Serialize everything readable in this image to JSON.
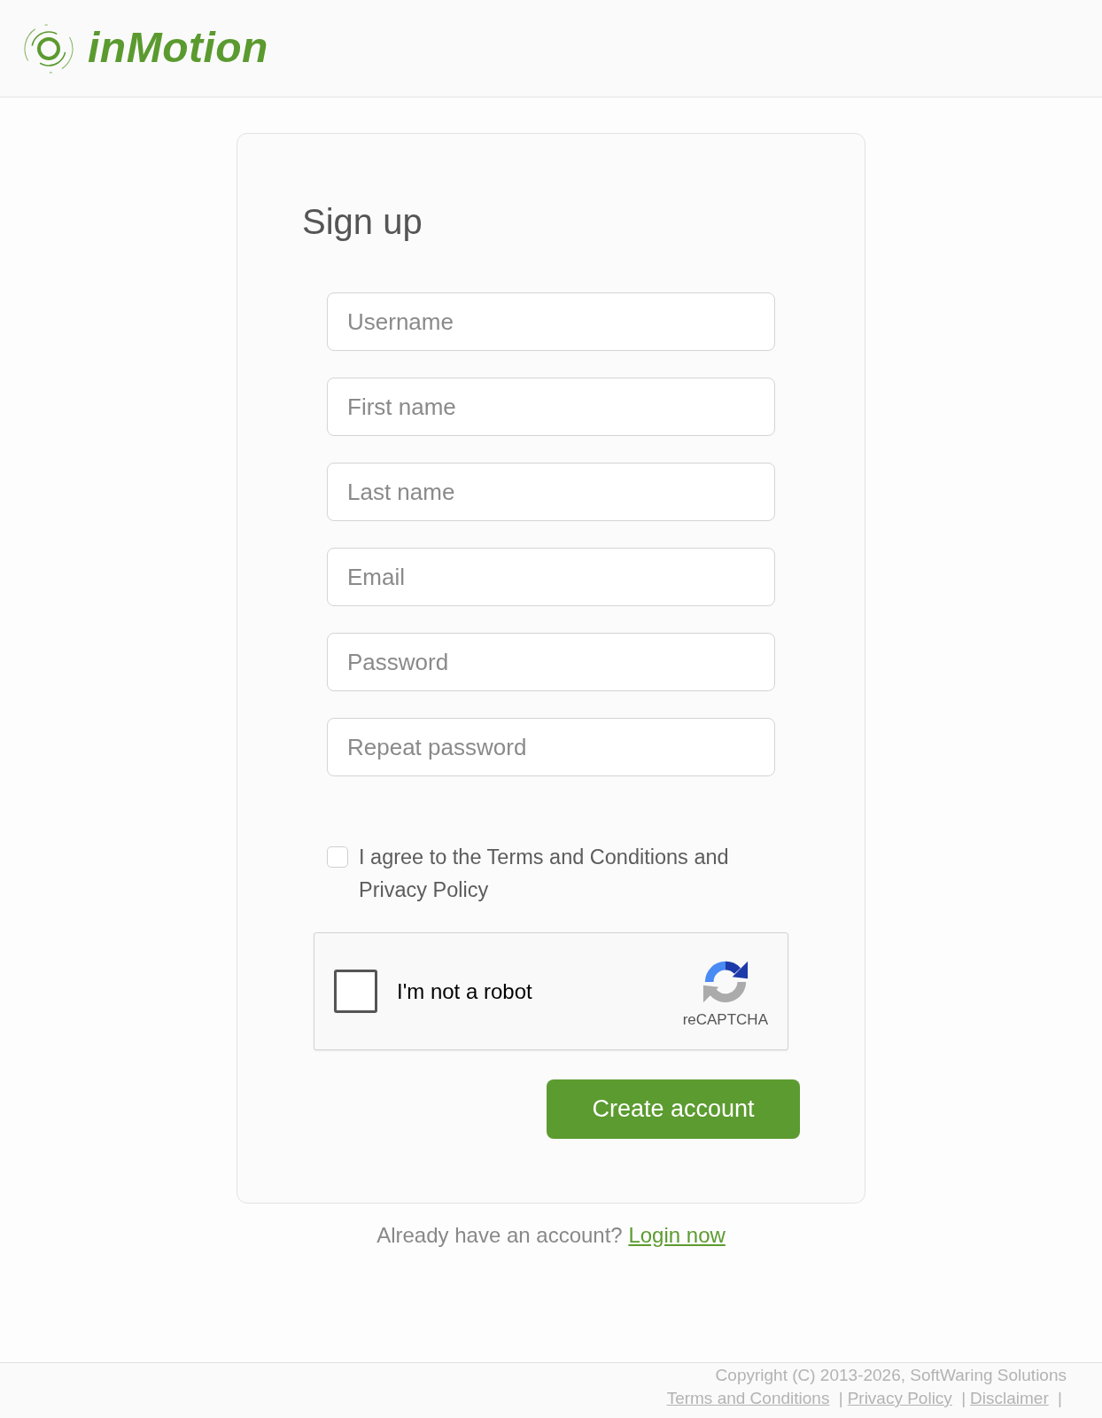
{
  "header": {
    "logo_text": "inMotion"
  },
  "form": {
    "title": "Sign up",
    "fields": [
      {
        "placeholder": "Username"
      },
      {
        "placeholder": "First name"
      },
      {
        "placeholder": "Last name"
      },
      {
        "placeholder": "Email"
      },
      {
        "placeholder": "Password"
      },
      {
        "placeholder": "Repeat password"
      }
    ],
    "agreement": {
      "label": "I agree to the Terms and Conditions and Privacy Policy",
      "checked": false
    },
    "captcha": {
      "label": "I'm not a robot",
      "brand": "reCAPTCHA",
      "checked": false
    },
    "submit": "Create account"
  },
  "login_prompt": {
    "text": "Already have an account?",
    "link": "Login now"
  },
  "footer": {
    "copyright": "Copyright (C) 2013-2026, SoftWaring Solutions",
    "links": [
      {
        "label": "Terms and Conditions",
        "separator": "|"
      },
      {
        "label": "Privacy Policy",
        "separator": "|"
      },
      {
        "label": "Disclaimer",
        "separator": "|"
      }
    ]
  }
}
